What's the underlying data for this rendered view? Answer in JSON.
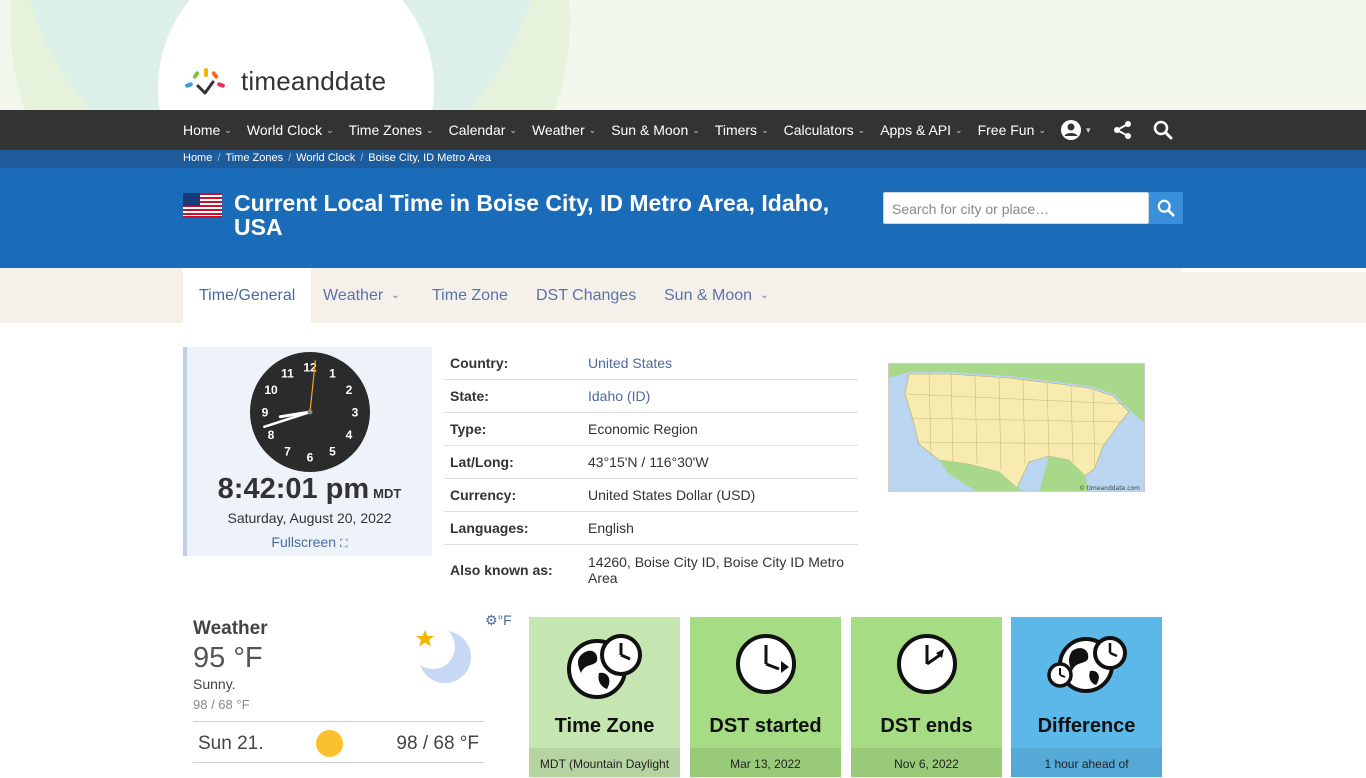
{
  "brand": {
    "logo_text": "timeanddate"
  },
  "nav": {
    "items": [
      {
        "label": "Home"
      },
      {
        "label": "World Clock"
      },
      {
        "label": "Time Zones"
      },
      {
        "label": "Calendar"
      },
      {
        "label": "Weather"
      },
      {
        "label": "Sun & Moon"
      },
      {
        "label": "Timers"
      },
      {
        "label": "Calculators"
      },
      {
        "label": "Apps & API"
      },
      {
        "label": "Free Fun"
      }
    ]
  },
  "breadcrumb": [
    "Home",
    "Time Zones",
    "World Clock",
    "Boise City, ID Metro Area"
  ],
  "page": {
    "title": "Current Local Time in Boise City, ID Metro Area, Idaho, USA",
    "search_placeholder": "Search for city or place…"
  },
  "tabs": [
    {
      "label": "Time/General",
      "active": true
    },
    {
      "label": "Weather",
      "dropdown": true
    },
    {
      "label": "Time Zone"
    },
    {
      "label": "DST Changes"
    },
    {
      "label": "Sun & Moon",
      "dropdown": true
    }
  ],
  "clock": {
    "time": "8:42:01 pm",
    "zone": "MDT",
    "date": "Saturday, August 20, 2022",
    "fullscreen_label": "Fullscreen",
    "numbers": [
      "12",
      "1",
      "2",
      "3",
      "4",
      "5",
      "6",
      "7",
      "8",
      "9",
      "10",
      "11"
    ],
    "hour": 8,
    "minute": 42,
    "second": 1
  },
  "info": [
    {
      "key": "Country:",
      "value": "United States",
      "link": true
    },
    {
      "key": "State:",
      "value": "Idaho (ID)",
      "link": true
    },
    {
      "key": "Type:",
      "value": "Economic Region"
    },
    {
      "key": "Lat/Long:",
      "value": "43°15'N / 116°30'W"
    },
    {
      "key": "Currency:",
      "value": "United States Dollar (USD)"
    },
    {
      "key": "Languages:",
      "value": "English"
    },
    {
      "key": "Also known as:",
      "value": "14260, Boise City ID, Boise City ID Metro Area"
    }
  ],
  "map": {
    "credit": "© timeanddate.com"
  },
  "weather": {
    "title": "Weather",
    "unit_label": "°F",
    "temp": "95 °F",
    "desc": "Sunny.",
    "range": "98 / 68 °F",
    "forecast_day": "Sun 21.",
    "forecast_range": "98 / 68 °F"
  },
  "cards": [
    {
      "label": "Time Zone",
      "sub": "MDT (Mountain Daylight",
      "color": "#c5e6b0"
    },
    {
      "label": "DST started",
      "sub": "Mar 13, 2022",
      "color": "#a6dc84"
    },
    {
      "label": "DST ends",
      "sub": "Nov 6, 2022",
      "color": "#a6dc84"
    },
    {
      "label": "Difference",
      "sub": "1 hour ahead of",
      "color": "#5db8ea"
    }
  ],
  "colors": {
    "nav_bg": "#333333",
    "header_bg": "#1a6bb8",
    "link": "#4a6aa0"
  }
}
